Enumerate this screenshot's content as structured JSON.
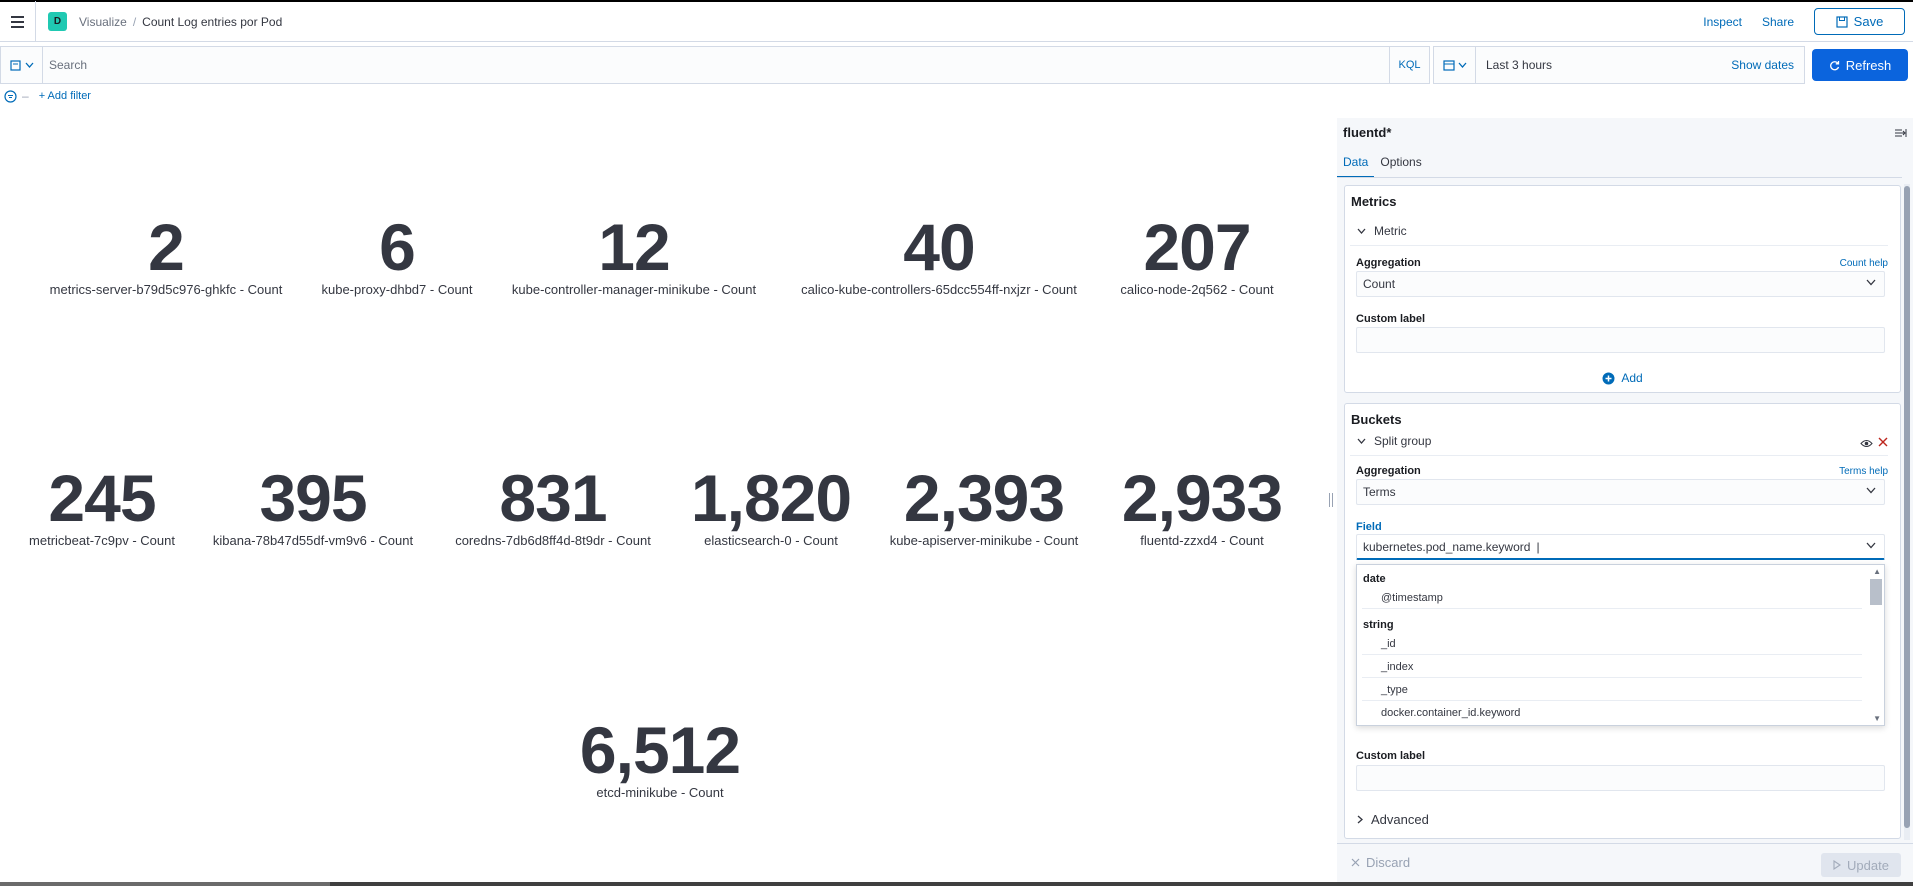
{
  "header": {
    "space_initial": "D",
    "breadcrumbs": [
      "Visualize",
      "Count Log entries por Pod"
    ],
    "inspect_label": "Inspect",
    "share_label": "Share",
    "save_label": "Save"
  },
  "query": {
    "search_placeholder": "Search",
    "language_label": "KQL",
    "time_range": "Last 3 hours",
    "show_dates_label": "Show dates",
    "refresh_label": "Refresh",
    "add_filter_label": "+ Add filter"
  },
  "metrics": [
    {
      "value": "2",
      "label": "metrics-server-b79d5c976-ghkfc - Count"
    },
    {
      "value": "6",
      "label": "kube-proxy-dhbd7 - Count"
    },
    {
      "value": "12",
      "label": "kube-controller-manager-minikube - Count"
    },
    {
      "value": "40",
      "label": "calico-kube-controllers-65dcc554ff-nxjzr - Count"
    },
    {
      "value": "207",
      "label": "calico-node-2q562 - Count"
    },
    {
      "value": "245",
      "label": "metricbeat-7c9pv - Count"
    },
    {
      "value": "395",
      "label": "kibana-78b47d55df-vm9v6 - Count"
    },
    {
      "value": "831",
      "label": "coredns-7db6d8ff4d-8t9dr - Count"
    },
    {
      "value": "1,820",
      "label": "elasticsearch-0 - Count"
    },
    {
      "value": "2,393",
      "label": "kube-apiserver-minikube - Count"
    },
    {
      "value": "2,933",
      "label": "fluentd-zzxd4 - Count"
    },
    {
      "value": "6,512",
      "label": "etcd-minikube - Count"
    }
  ],
  "sidebar": {
    "index_pattern": "fluentd*",
    "tabs": [
      "Data",
      "Options"
    ],
    "metrics_panel": {
      "title": "Metrics",
      "accordion_label": "Metric",
      "aggregation_label": "Aggregation",
      "aggregation_help": "Count help",
      "aggregation_value": "Count",
      "custom_label": "Custom label",
      "add_label": "Add"
    },
    "buckets_panel": {
      "title": "Buckets",
      "accordion_label": "Split group",
      "aggregation_label": "Aggregation",
      "aggregation_help": "Terms help",
      "aggregation_value": "Terms",
      "field_label": "Field",
      "field_value": "kubernetes.pod_name.keyword",
      "dropdown": {
        "groups": [
          {
            "name": "date",
            "items": [
              "@timestamp"
            ]
          },
          {
            "name": "string",
            "items": [
              "_id",
              "_index",
              "_type",
              "docker.container_id.keyword"
            ]
          }
        ]
      },
      "custom_label": "Custom label",
      "advanced_label": "Advanced"
    },
    "discard_label": "Discard",
    "update_label": "Update"
  },
  "colors": {
    "accent": "#006bb8",
    "refresh_bg": "#0b64dd",
    "space_badge": "#20c9b2",
    "danger": "#bd271e"
  }
}
